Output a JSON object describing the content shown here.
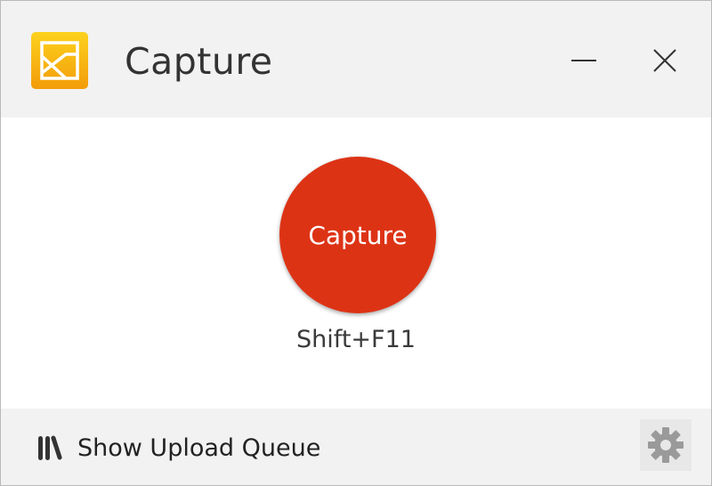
{
  "window": {
    "title": "Capture",
    "icons": {
      "app": "app-logo-icon",
      "minimize": "minimize-icon",
      "close": "close-icon"
    }
  },
  "main": {
    "capture_button_label": "Capture",
    "shortcut": "Shift+F11"
  },
  "footer": {
    "upload_queue_label": "Show Upload Queue",
    "upload_queue_icon": "books-icon",
    "settings_icon": "gear-icon"
  },
  "colors": {
    "accent": "#dd3315",
    "logo_yellow": "#f7b80f",
    "title_bar": "#f2f2f2"
  }
}
